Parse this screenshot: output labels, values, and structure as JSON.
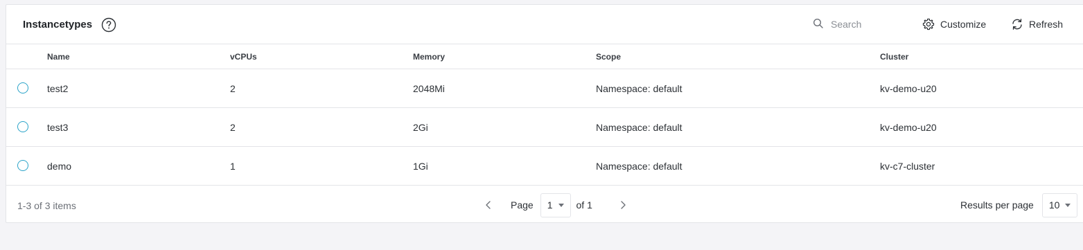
{
  "header": {
    "title": "Instancetypes",
    "search_placeholder": "Search",
    "customize_label": "Customize",
    "refresh_label": "Refresh"
  },
  "table": {
    "columns": [
      "Name",
      "vCPUs",
      "Memory",
      "Scope",
      "Cluster"
    ],
    "rows": [
      {
        "name": "test2",
        "vcpus": "2",
        "memory": "2048Mi",
        "scope": "Namespace: default",
        "cluster": "kv-demo-u20"
      },
      {
        "name": "test3",
        "vcpus": "2",
        "memory": "2Gi",
        "scope": "Namespace: default",
        "cluster": "kv-demo-u20"
      },
      {
        "name": "demo",
        "vcpus": "1",
        "memory": "1Gi",
        "scope": "Namespace: default",
        "cluster": "kv-c7-cluster"
      }
    ]
  },
  "footer": {
    "item_count": "1-3 of 3 items",
    "page_label": "Page",
    "page_value": "1",
    "of_label": "of 1",
    "results_per_page_label": "Results per page",
    "results_per_page_value": "10"
  },
  "colors": {
    "radio_accent": "#2aa3c8",
    "border": "#e3e4e8",
    "background": "#f4f4f7"
  },
  "icons": [
    "help-icon",
    "search-icon",
    "gear-icon",
    "refresh-icon",
    "chevron-left-icon",
    "chevron-right-icon",
    "caret-down-icon"
  ]
}
